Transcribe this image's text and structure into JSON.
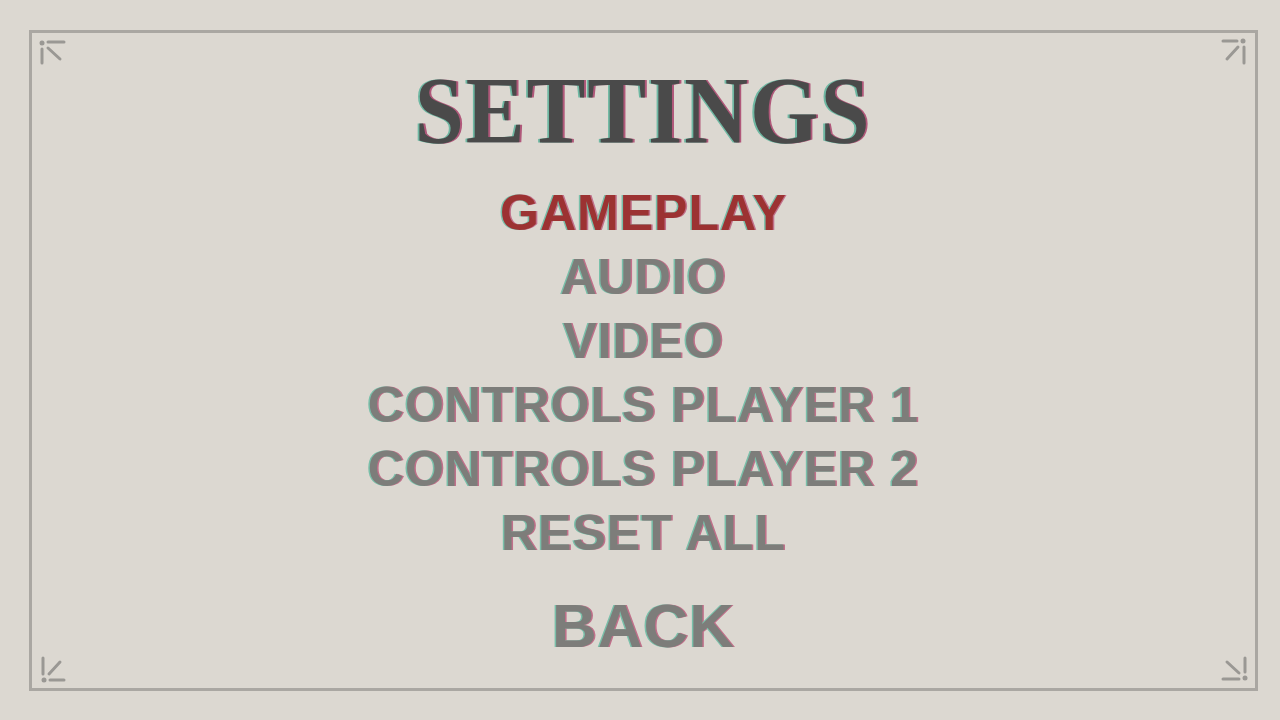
{
  "title": "SETTINGS",
  "menu": [
    {
      "label": "GAMEPLAY",
      "selected": true
    },
    {
      "label": "AUDIO",
      "selected": false
    },
    {
      "label": "VIDEO",
      "selected": false
    },
    {
      "label": "CONTROLS PLAYER 1",
      "selected": false
    },
    {
      "label": "CONTROLS PLAYER 2",
      "selected": false
    },
    {
      "label": "RESET ALL",
      "selected": false
    }
  ],
  "back": {
    "label": "BACK",
    "selected": false
  }
}
